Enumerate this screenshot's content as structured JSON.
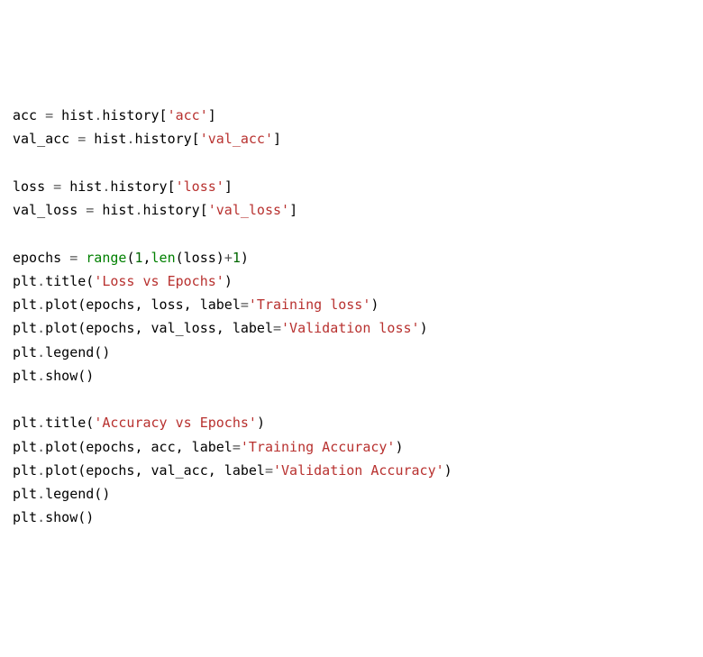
{
  "code": {
    "lines": [
      {
        "tokens": [
          {
            "t": "acc ",
            "c": "tok-default"
          },
          {
            "t": "=",
            "c": "tok-op"
          },
          {
            "t": " hist",
            "c": "tok-default"
          },
          {
            "t": ".",
            "c": "tok-op"
          },
          {
            "t": "history[",
            "c": "tok-default"
          },
          {
            "t": "'acc'",
            "c": "tok-string"
          },
          {
            "t": "]",
            "c": "tok-default"
          }
        ]
      },
      {
        "tokens": [
          {
            "t": "val_acc ",
            "c": "tok-default"
          },
          {
            "t": "=",
            "c": "tok-op"
          },
          {
            "t": " hist",
            "c": "tok-default"
          },
          {
            "t": ".",
            "c": "tok-op"
          },
          {
            "t": "history[",
            "c": "tok-default"
          },
          {
            "t": "'val_acc'",
            "c": "tok-string"
          },
          {
            "t": "]",
            "c": "tok-default"
          }
        ]
      },
      {
        "tokens": [
          {
            "t": " ",
            "c": "tok-default"
          }
        ]
      },
      {
        "tokens": [
          {
            "t": "loss ",
            "c": "tok-default"
          },
          {
            "t": "=",
            "c": "tok-op"
          },
          {
            "t": " hist",
            "c": "tok-default"
          },
          {
            "t": ".",
            "c": "tok-op"
          },
          {
            "t": "history[",
            "c": "tok-default"
          },
          {
            "t": "'loss'",
            "c": "tok-string"
          },
          {
            "t": "]",
            "c": "tok-default"
          }
        ]
      },
      {
        "tokens": [
          {
            "t": "val_loss ",
            "c": "tok-default"
          },
          {
            "t": "=",
            "c": "tok-op"
          },
          {
            "t": " hist",
            "c": "tok-default"
          },
          {
            "t": ".",
            "c": "tok-op"
          },
          {
            "t": "history[",
            "c": "tok-default"
          },
          {
            "t": "'val_loss'",
            "c": "tok-string"
          },
          {
            "t": "]",
            "c": "tok-default"
          }
        ]
      },
      {
        "tokens": [
          {
            "t": " ",
            "c": "tok-default"
          }
        ]
      },
      {
        "tokens": [
          {
            "t": "epochs ",
            "c": "tok-default"
          },
          {
            "t": "=",
            "c": "tok-op"
          },
          {
            "t": " ",
            "c": "tok-default"
          },
          {
            "t": "range",
            "c": "tok-builtin"
          },
          {
            "t": "(",
            "c": "tok-default"
          },
          {
            "t": "1",
            "c": "tok-number"
          },
          {
            "t": ",",
            "c": "tok-default"
          },
          {
            "t": "len",
            "c": "tok-builtin"
          },
          {
            "t": "(loss)",
            "c": "tok-default"
          },
          {
            "t": "+",
            "c": "tok-op"
          },
          {
            "t": "1",
            "c": "tok-number"
          },
          {
            "t": ")",
            "c": "tok-default"
          }
        ]
      },
      {
        "tokens": [
          {
            "t": "plt",
            "c": "tok-default"
          },
          {
            "t": ".",
            "c": "tok-op"
          },
          {
            "t": "title(",
            "c": "tok-default"
          },
          {
            "t": "'Loss vs Epochs'",
            "c": "tok-string"
          },
          {
            "t": ")",
            "c": "tok-default"
          }
        ]
      },
      {
        "tokens": [
          {
            "t": "plt",
            "c": "tok-default"
          },
          {
            "t": ".",
            "c": "tok-op"
          },
          {
            "t": "plot(epochs, loss, label",
            "c": "tok-default"
          },
          {
            "t": "=",
            "c": "tok-op"
          },
          {
            "t": "'Training loss'",
            "c": "tok-string"
          },
          {
            "t": ")",
            "c": "tok-default"
          }
        ]
      },
      {
        "tokens": [
          {
            "t": "plt",
            "c": "tok-default"
          },
          {
            "t": ".",
            "c": "tok-op"
          },
          {
            "t": "plot(epochs, val_loss, label",
            "c": "tok-default"
          },
          {
            "t": "=",
            "c": "tok-op"
          },
          {
            "t": "'Validation loss'",
            "c": "tok-string"
          },
          {
            "t": ")",
            "c": "tok-default"
          }
        ]
      },
      {
        "tokens": [
          {
            "t": "plt",
            "c": "tok-default"
          },
          {
            "t": ".",
            "c": "tok-op"
          },
          {
            "t": "legend()",
            "c": "tok-default"
          }
        ]
      },
      {
        "tokens": [
          {
            "t": "plt",
            "c": "tok-default"
          },
          {
            "t": ".",
            "c": "tok-op"
          },
          {
            "t": "show()",
            "c": "tok-default"
          }
        ]
      },
      {
        "tokens": [
          {
            "t": " ",
            "c": "tok-default"
          }
        ]
      },
      {
        "tokens": [
          {
            "t": "plt",
            "c": "tok-default"
          },
          {
            "t": ".",
            "c": "tok-op"
          },
          {
            "t": "title(",
            "c": "tok-default"
          },
          {
            "t": "'Accuracy vs Epochs'",
            "c": "tok-string"
          },
          {
            "t": ")",
            "c": "tok-default"
          }
        ]
      },
      {
        "tokens": [
          {
            "t": "plt",
            "c": "tok-default"
          },
          {
            "t": ".",
            "c": "tok-op"
          },
          {
            "t": "plot(epochs, acc, label",
            "c": "tok-default"
          },
          {
            "t": "=",
            "c": "tok-op"
          },
          {
            "t": "'Training Accuracy'",
            "c": "tok-string"
          },
          {
            "t": ")",
            "c": "tok-default"
          }
        ]
      },
      {
        "tokens": [
          {
            "t": "plt",
            "c": "tok-default"
          },
          {
            "t": ".",
            "c": "tok-op"
          },
          {
            "t": "plot(epochs, val_acc, label",
            "c": "tok-default"
          },
          {
            "t": "=",
            "c": "tok-op"
          },
          {
            "t": "'Validation Accuracy'",
            "c": "tok-string"
          },
          {
            "t": ")",
            "c": "tok-default"
          }
        ]
      },
      {
        "tokens": [
          {
            "t": "plt",
            "c": "tok-default"
          },
          {
            "t": ".",
            "c": "tok-op"
          },
          {
            "t": "legend()",
            "c": "tok-default"
          }
        ]
      },
      {
        "tokens": [
          {
            "t": "plt",
            "c": "tok-default"
          },
          {
            "t": ".",
            "c": "tok-op"
          },
          {
            "t": "show()",
            "c": "tok-default"
          }
        ]
      }
    ]
  }
}
